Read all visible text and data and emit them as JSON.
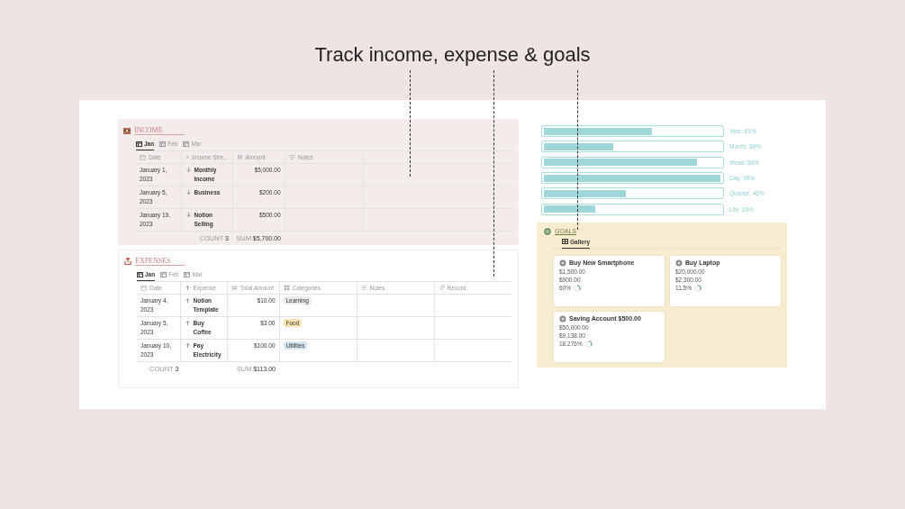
{
  "headline": "Track income, expense & goals",
  "income": {
    "title": "INCOME",
    "tabs": [
      {
        "label": "Jan",
        "selected": true
      },
      {
        "label": "Feb",
        "selected": false
      },
      {
        "label": "Mar",
        "selected": false
      }
    ],
    "columns": [
      {
        "label": "Date",
        "kind": "date"
      },
      {
        "label": "Income Stre...",
        "kind": "down"
      },
      {
        "label": "Amount",
        "kind": "number"
      },
      {
        "label": "Notes",
        "kind": "text"
      }
    ],
    "rows": [
      {
        "date": "January 1, 2023",
        "name": "Monthly Income",
        "amount": "$5,000.00"
      },
      {
        "date": "January 5, 2023",
        "name": "Business",
        "amount": "$200.00"
      },
      {
        "date": "January 19, 2023",
        "name": "Notion Selling",
        "amount": "$500.00"
      }
    ],
    "count_label": "COUNT",
    "count": "3",
    "sum_label": "SUM",
    "sum": "$5,700.00"
  },
  "expenses": {
    "title": "EXPENSES",
    "tabs": [
      {
        "label": "Jan",
        "selected": true
      },
      {
        "label": "Feb",
        "selected": false
      },
      {
        "label": "Mar",
        "selected": false
      }
    ],
    "columns": [
      {
        "label": "Date",
        "kind": "date"
      },
      {
        "label": "Expense",
        "kind": "up"
      },
      {
        "label": "Total Amount",
        "kind": "number"
      },
      {
        "label": "Categories",
        "kind": "select"
      },
      {
        "label": "Notes",
        "kind": "text"
      },
      {
        "label": "Record",
        "kind": "file"
      }
    ],
    "rows": [
      {
        "date": "January 4, 2023",
        "name": "Notion Template",
        "amount": "$10.00",
        "category": "Learning",
        "color": "#ebeae8"
      },
      {
        "date": "January 5, 2023",
        "name": "Buy Coffee",
        "amount": "$3.00",
        "category": "Food",
        "color": "#fbe4b4"
      },
      {
        "date": "January 10, 2023",
        "name": "Pay Electricity",
        "amount": "$100.00",
        "category": "Utilities",
        "color": "#d5e7f2"
      }
    ],
    "count_label": "COUNT",
    "count": "3",
    "sum_label": "SUM",
    "sum": "$113.00"
  },
  "progress": [
    {
      "label": "Year: 61%",
      "level": 0.61
    },
    {
      "label": "Month: 39%",
      "level": 0.39
    },
    {
      "label": "Week: 86%",
      "level": 0.86
    },
    {
      "label": "Day: 99%",
      "level": 0.99
    },
    {
      "label": "Quarter: 46%",
      "level": 0.46
    },
    {
      "label": "Life: 29%",
      "level": 0.29
    }
  ],
  "goals": {
    "title": "GOALS",
    "tabs": [
      {
        "label": "Gallery",
        "selected": true
      }
    ],
    "cards": [
      {
        "title": "Buy New Smartphone",
        "target": "$1,500.00",
        "saved": "$900.00",
        "percent": "60%"
      },
      {
        "title": "Buy Laptop",
        "target": "$20,000.00",
        "saved": "$2,300.00",
        "percent": "11.5%"
      },
      {
        "title": "Saving Account $500.00",
        "target": "$50,000.00",
        "saved": "$9,138.00",
        "percent": "18.276%"
      }
    ]
  }
}
